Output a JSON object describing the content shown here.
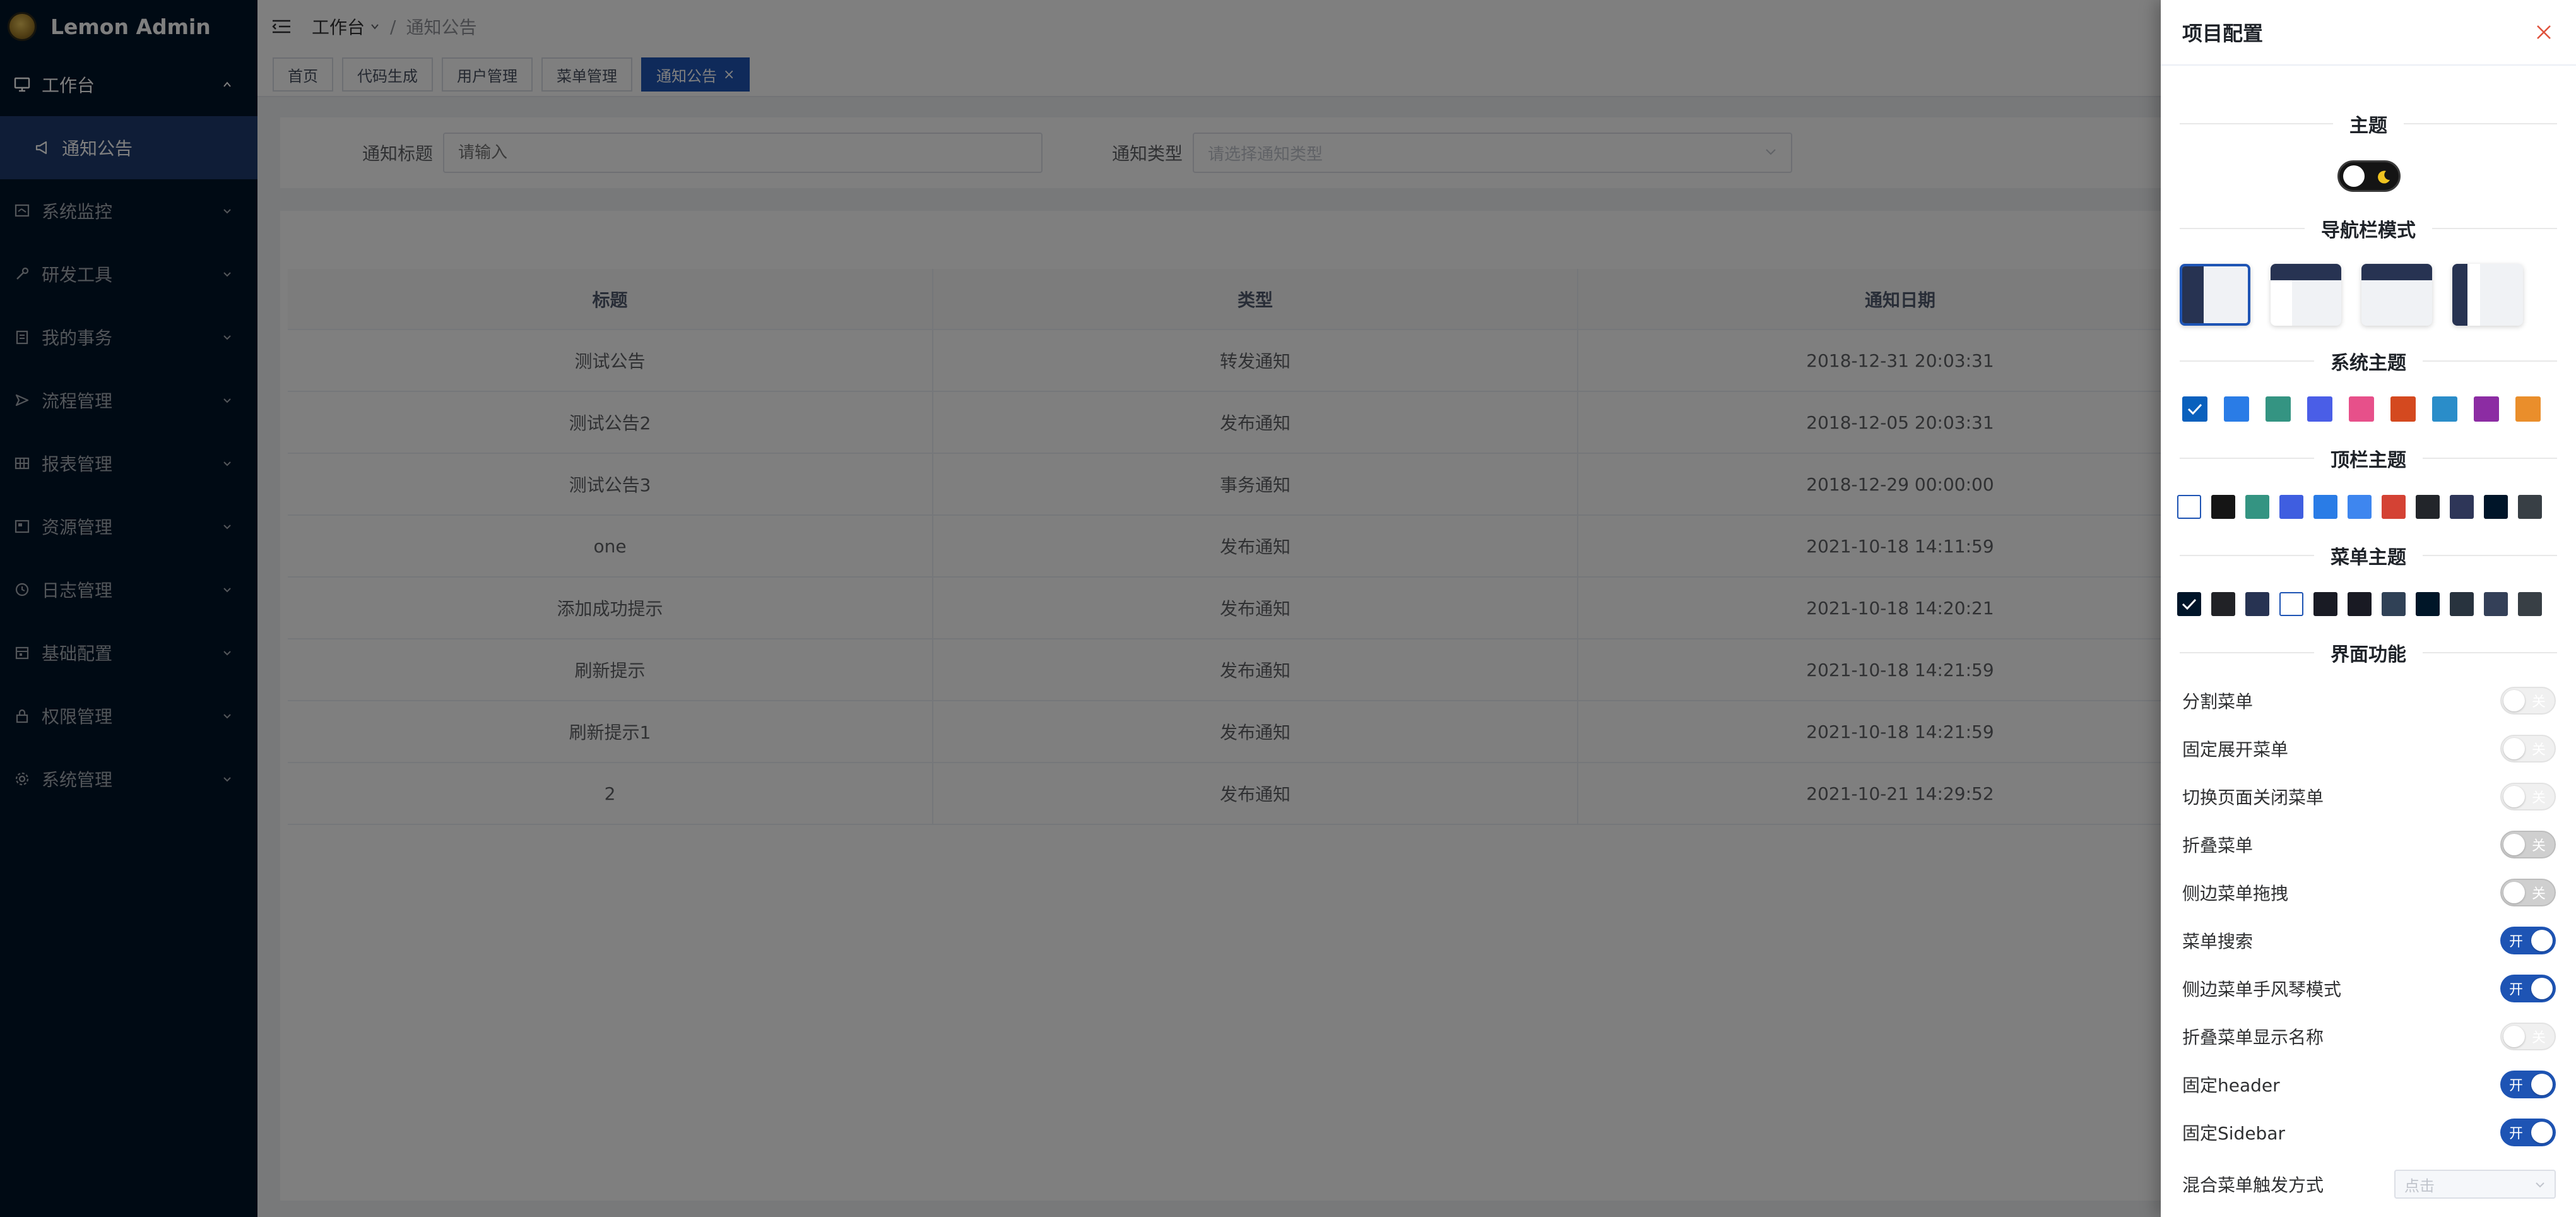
{
  "app": {
    "title": "Lemon Admin"
  },
  "sidebar": {
    "items": [
      {
        "label": "工作台",
        "icon": "monitor-icon",
        "open": true
      },
      {
        "label": "系统监控",
        "icon": "dashboard-icon"
      },
      {
        "label": "研发工具",
        "icon": "tool-icon"
      },
      {
        "label": "我的事务",
        "icon": "document-icon"
      },
      {
        "label": "流程管理",
        "icon": "send-icon"
      },
      {
        "label": "报表管理",
        "icon": "table-icon"
      },
      {
        "label": "资源管理",
        "icon": "image-icon"
      },
      {
        "label": "日志管理",
        "icon": "clock-icon"
      },
      {
        "label": "基础配置",
        "icon": "calendar-icon"
      },
      {
        "label": "权限管理",
        "icon": "lock-icon"
      },
      {
        "label": "系统管理",
        "icon": "gear-icon"
      }
    ],
    "active_sub": {
      "label": "通知公告",
      "icon": "megaphone-icon"
    }
  },
  "header": {
    "breadcrumb": {
      "root": "工作台",
      "sep": "/",
      "current": "通知公告"
    }
  },
  "tags": [
    {
      "label": "首页"
    },
    {
      "label": "代码生成"
    },
    {
      "label": "用户管理"
    },
    {
      "label": "菜单管理"
    },
    {
      "label": "通知公告",
      "active": true,
      "close": "×"
    }
  ],
  "search": {
    "title_label": "通知标题",
    "title_placeholder": "请输入",
    "type_label": "通知类型",
    "type_placeholder": "请选择通知类型"
  },
  "table": {
    "columns": [
      "标题",
      "类型",
      "通知日期"
    ],
    "rows": [
      [
        "测试公告",
        "转发通知",
        "2018-12-31 20:03:31"
      ],
      [
        "测试公告2",
        "发布通知",
        "2018-12-05 20:03:31"
      ],
      [
        "测试公告3",
        "事务通知",
        "2018-12-29 00:00:00"
      ],
      [
        "one",
        "发布通知",
        "2021-10-18 14:11:59"
      ],
      [
        "添加成功提示",
        "发布通知",
        "2021-10-18 14:20:21"
      ],
      [
        "刷新提示",
        "发布通知",
        "2021-10-18 14:21:59"
      ],
      [
        "刷新提示1",
        "发布通知",
        "2021-10-18 14:21:59"
      ],
      [
        "2",
        "发布通知",
        "2021-10-21 14:29:52"
      ]
    ]
  },
  "drawer": {
    "title": "项目配置",
    "sections": {
      "theme": "主题",
      "nav_mode": "导航栏模式",
      "system_theme": "系统主题",
      "header_theme": "顶栏主题",
      "menu_theme": "菜单主题",
      "features": "界面功能"
    },
    "system_theme_colors": [
      "#0960bd",
      "#2a7ce6",
      "#349482",
      "#4a5ee7",
      "#e7508a",
      "#d4491f",
      "#2a8dc9",
      "#8c2ca3",
      "#ea8e2b"
    ],
    "header_theme_colors": [
      "#ffffff",
      "#151515",
      "#349482",
      "#3f5ee0",
      "#2a7ce6",
      "#3e86ef",
      "#d44234",
      "#22252a",
      "#2e3658",
      "#001529",
      "#383f45"
    ],
    "menu_theme_colors": [
      "#001529",
      "#212226",
      "#273352",
      "#ffffff",
      "#191b24",
      "#191a23",
      "#304156",
      "#001628",
      "#28333e",
      "#344058",
      "#383f45"
    ],
    "features": [
      {
        "label": "分割菜单",
        "state": "off-light",
        "text": "关"
      },
      {
        "label": "固定展开菜单",
        "state": "off-light",
        "text": "关"
      },
      {
        "label": "切换页面关闭菜单",
        "state": "off-light",
        "text": "关"
      },
      {
        "label": "折叠菜单",
        "state": "off-dark",
        "text": "关"
      },
      {
        "label": "侧边菜单拖拽",
        "state": "off-dark",
        "text": "关"
      },
      {
        "label": "菜单搜索",
        "state": "on",
        "text": "开"
      },
      {
        "label": "侧边菜单手风琴模式",
        "state": "on",
        "text": "开"
      },
      {
        "label": "折叠菜单显示名称",
        "state": "off-light",
        "text": "关"
      },
      {
        "label": "固定header",
        "state": "on",
        "text": "开"
      },
      {
        "label": "固定Sidebar",
        "state": "on",
        "text": "开"
      }
    ],
    "trigger": {
      "label": "混合菜单触发方式",
      "value": "点击"
    }
  },
  "colors": {
    "primary": "#1e54b4",
    "sidebar_bg": "#001529",
    "submenu_bg": "#1e3b6e"
  }
}
